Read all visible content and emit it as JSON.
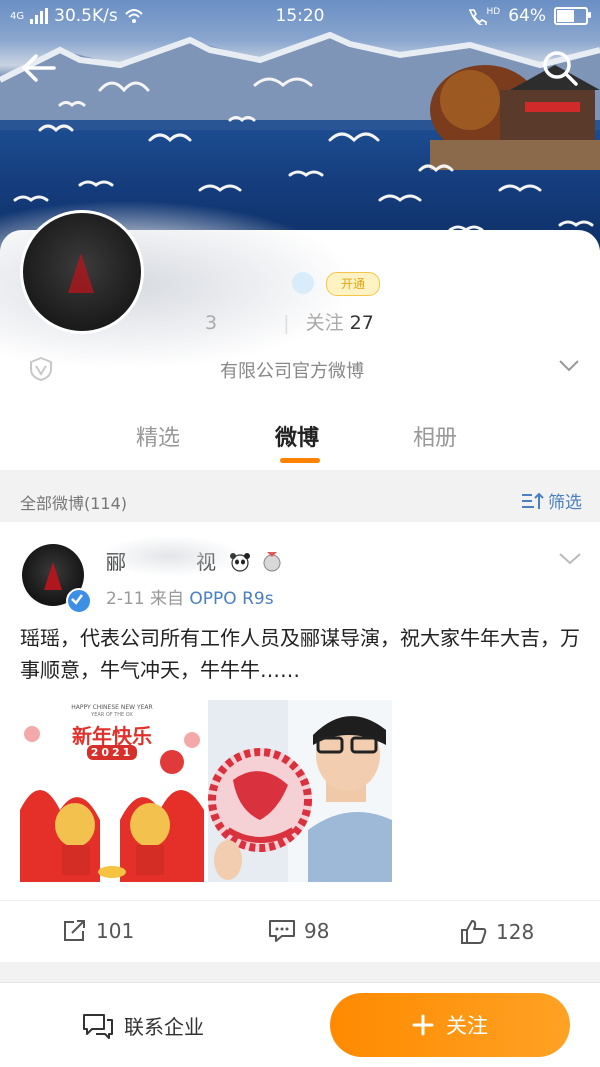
{
  "status_bar": {
    "network": "4G",
    "speed": "30.5K/s",
    "time": "15:20",
    "hd": "HD",
    "battery": "64%",
    "battery_level": 0.64
  },
  "profile": {
    "follow_label": "关注",
    "follow_count": "27",
    "followers_partial": "3",
    "description_partial": "有限公司官方微博",
    "open_badge": "开通"
  },
  "tabs": [
    {
      "label": "精选",
      "active": false
    },
    {
      "label": "微博",
      "active": true
    },
    {
      "label": "相册",
      "active": false
    }
  ],
  "filter": {
    "all_label": "全部微博(114)",
    "filter_label": "筛选"
  },
  "post": {
    "name_partial": "郦",
    "name_tail": "视",
    "date": "2-11",
    "source_prefix": "来自",
    "source": "OPPO R9s",
    "text": "瑶瑶，代表公司所有工作人员及郦谋导演，祝大家牛年大吉，万事顺意，牛气冲天，牛牛牛……",
    "image1": {
      "header": "HAPPY CHINESE NEW YEAR",
      "subheader": "YEAR OF THE OX",
      "title": "新年快乐",
      "year": "2021"
    },
    "reposts": "101",
    "comments": "98",
    "likes": "128"
  },
  "bottom": {
    "contact_label": "联系企业",
    "follow_label": "关注"
  },
  "colors": {
    "accent": "#ff8200",
    "link": "#4a7fc1",
    "verify": "#3d8fe6"
  }
}
